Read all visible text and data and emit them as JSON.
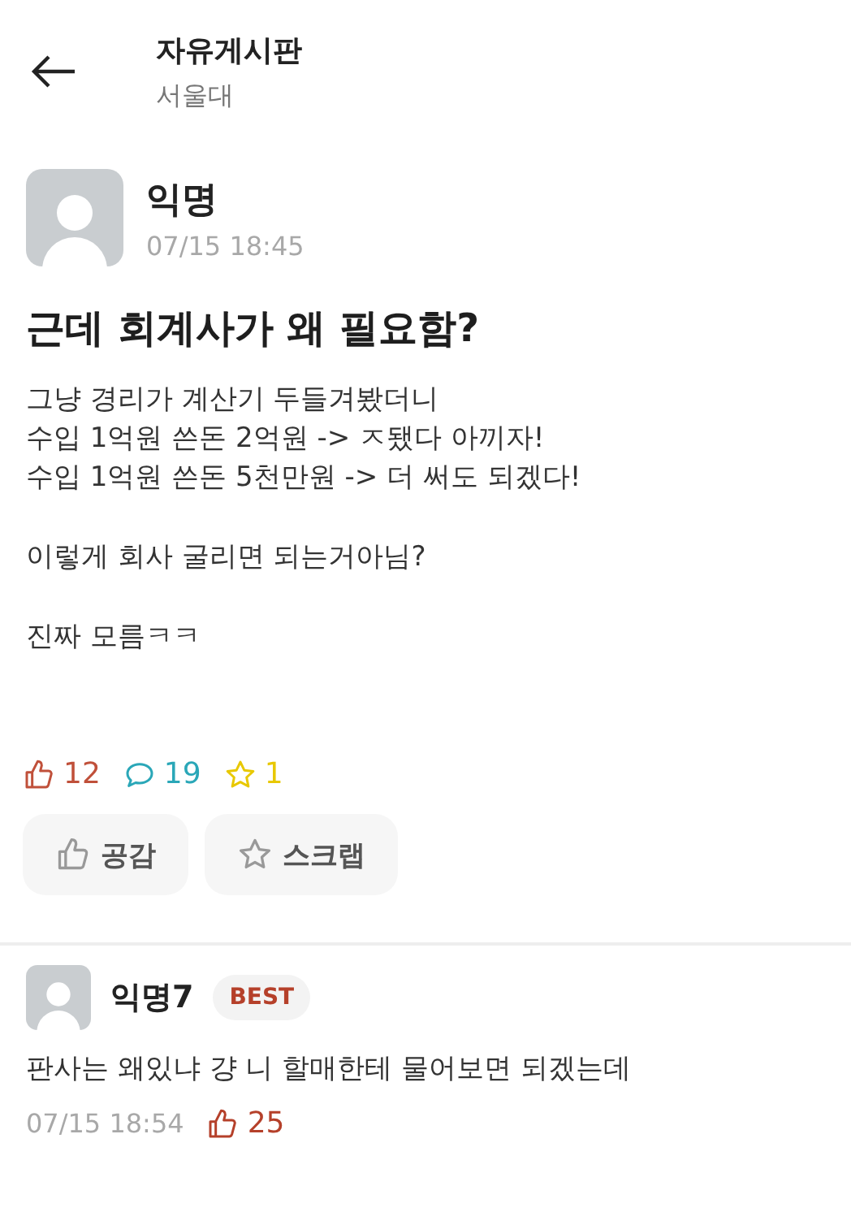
{
  "header": {
    "title": "자유게시판",
    "subtitle": "서울대"
  },
  "post": {
    "author": "익명",
    "time": "07/15 18:45",
    "title": "근데 회계사가 왜 필요함?",
    "paragraphs": [
      [
        "그냥 경리가 계산기 두들겨봤더니",
        "수입 1억원 쓴돈 2억원 -> ㅈ됐다 아끼자!",
        "수입 1억원 쓴돈 5천만원 -> 더 써도 되겠다!"
      ],
      [
        "이렇게 회사 굴리면 되는거아님?"
      ],
      [
        "진짜 모름ㅋㅋ"
      ]
    ],
    "stats": [
      {
        "kind": "like",
        "count": "12",
        "color": "#c0503a"
      },
      {
        "kind": "comment",
        "count": "19",
        "color": "#2aa7b8"
      },
      {
        "kind": "scrap",
        "count": "1",
        "color": "#e8c800"
      }
    ],
    "buttons": [
      {
        "kind": "like",
        "label": "공감"
      },
      {
        "kind": "scrap",
        "label": "스크랩"
      }
    ]
  },
  "comments": [
    {
      "author": "익명7",
      "badge": "BEST",
      "text": "판사는 왜있냐 걍 니 할매한테 물어보면 되겠는데",
      "time": "07/15 18:54",
      "likes": "25"
    }
  ]
}
